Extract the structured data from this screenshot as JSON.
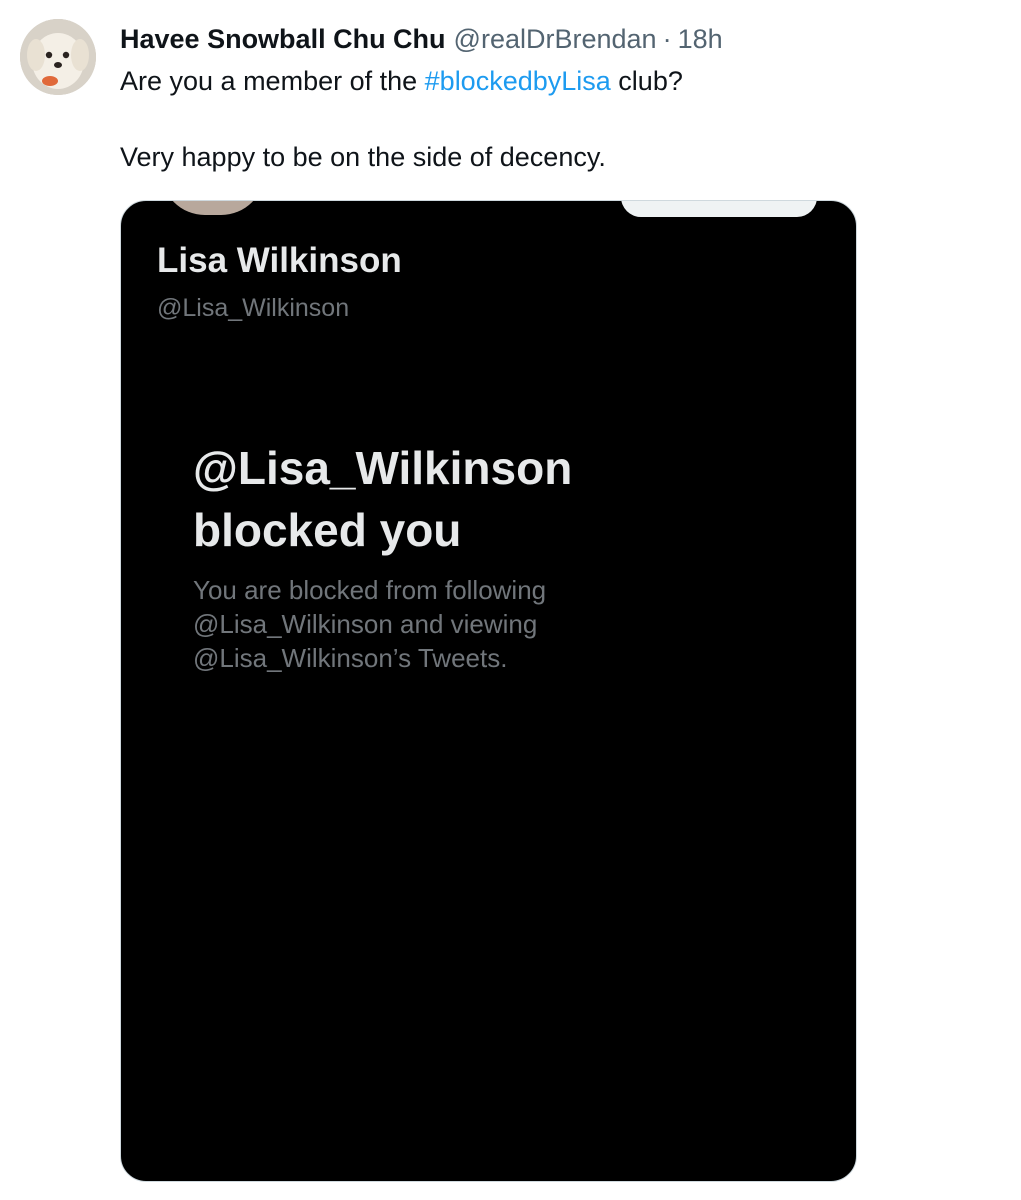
{
  "tweet": {
    "display_name": "Havee Snowball Chu Chu",
    "handle": "@realDrBrendan",
    "separator": "·",
    "timestamp": "18h",
    "text_line1_before": "Are you a member of the ",
    "hashtag": "#blockedbyLisa",
    "text_line1_after": " club?",
    "text_line2": "Very happy to be on the side of decency.",
    "hashtag_color": "#1d9bf0"
  },
  "media_screenshot": {
    "profile_name": "Lisa Wilkinson",
    "profile_handle": "@Lisa_Wilkinson",
    "blocked_title_line1": "@Lisa_Wilkinson",
    "blocked_title_line2": "blocked you",
    "blocked_body_line1": "You are blocked from following",
    "blocked_body_line2": "@Lisa_Wilkinson and viewing",
    "blocked_body_line3": "@Lisa_Wilkinson’s Tweets.",
    "background_color": "#000000"
  }
}
